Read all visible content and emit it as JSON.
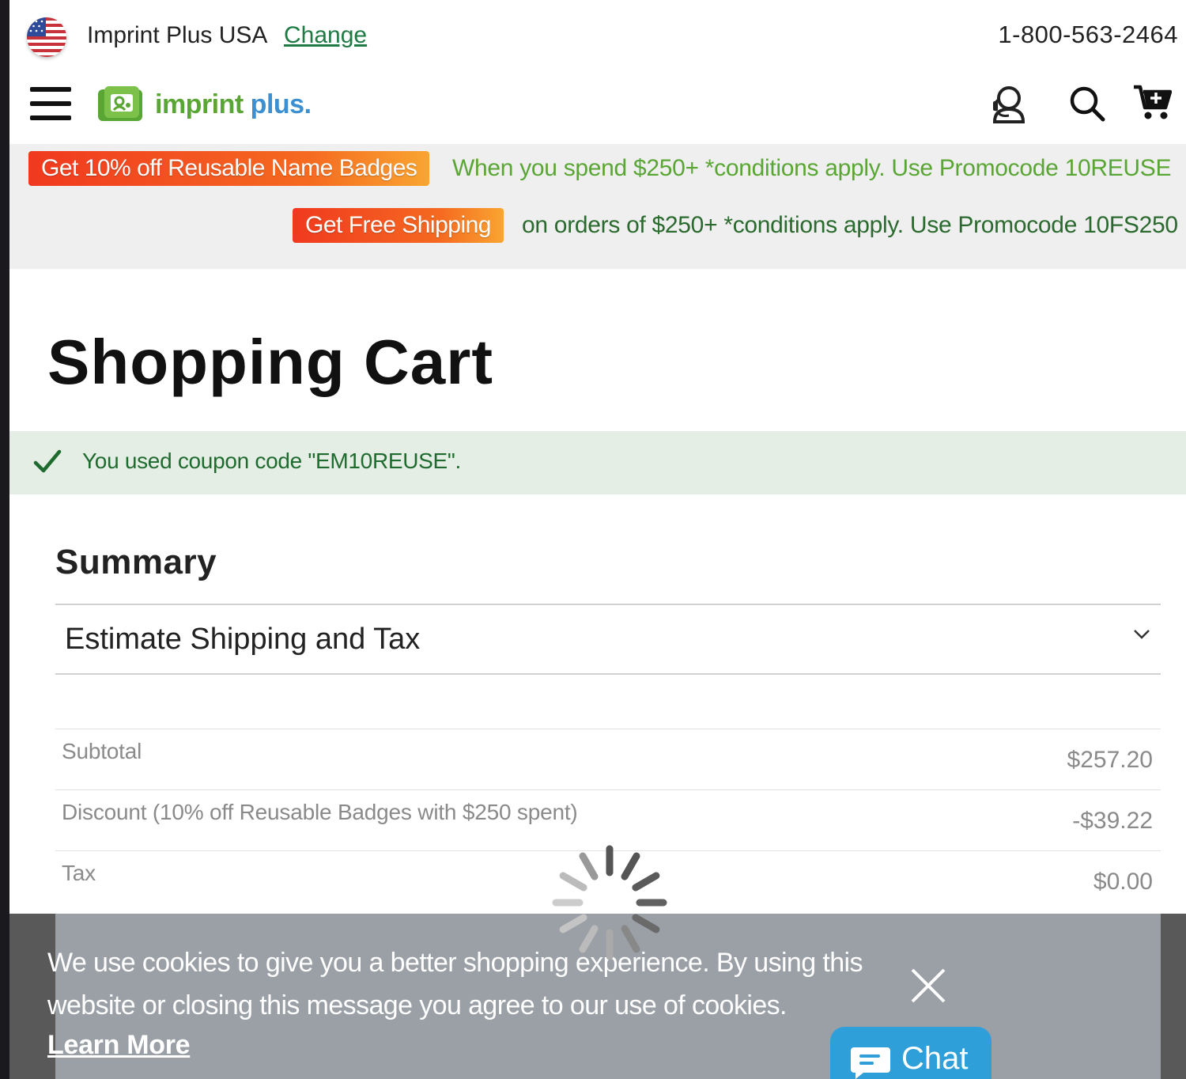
{
  "topbar": {
    "store_name": "Imprint Plus USA",
    "change_label": "Change",
    "phone": "1-800-563-2464"
  },
  "header": {
    "logo_word1": "imprint",
    "logo_word2": "plus",
    "logo_dot": "."
  },
  "promos": [
    {
      "badge": "Get 10% off Reusable Name Badges",
      "text": "When you spend $250+ *conditions apply. Use Promocode 10REUSE"
    },
    {
      "badge": "Get Free Shipping",
      "text": "on orders of $250+ *conditions apply. Use Promocode 10FS250"
    }
  ],
  "page_title": "Shopping Cart",
  "coupon_message": "You used coupon code \"EM10REUSE\".",
  "summary": {
    "title": "Summary",
    "estimate_label": "Estimate Shipping and Tax",
    "rows": [
      {
        "label": "Subtotal",
        "value": "$257.20"
      },
      {
        "label": "Discount (10% off Reusable Badges with $250 spent)",
        "value": "-$39.22"
      },
      {
        "label": "Tax",
        "value": "$0.00"
      }
    ]
  },
  "cookie": {
    "message": "We use cookies to give you a better shopping experience. By using this website or closing this message you agree to our use of cookies.",
    "learn_more": "Learn More"
  },
  "chat": {
    "label": "Chat"
  },
  "colors": {
    "brand_green": "#5aa635",
    "brand_blue": "#3c8fd0",
    "promo_orange": "#f0391f",
    "promo_text_green": "#5aa635",
    "promo_text_dark_green": "#2b6a2f",
    "coupon_bg": "#e5eee5",
    "chat_blue": "#2e9fd8"
  },
  "icons": [
    "us-flag-icon",
    "hamburger-menu-icon",
    "logo-icon",
    "account-icon",
    "search-icon",
    "cart-icon",
    "checkmark-icon",
    "chevron-down-icon",
    "close-icon",
    "chat-bubble-icon",
    "loading-spinner-icon"
  ]
}
